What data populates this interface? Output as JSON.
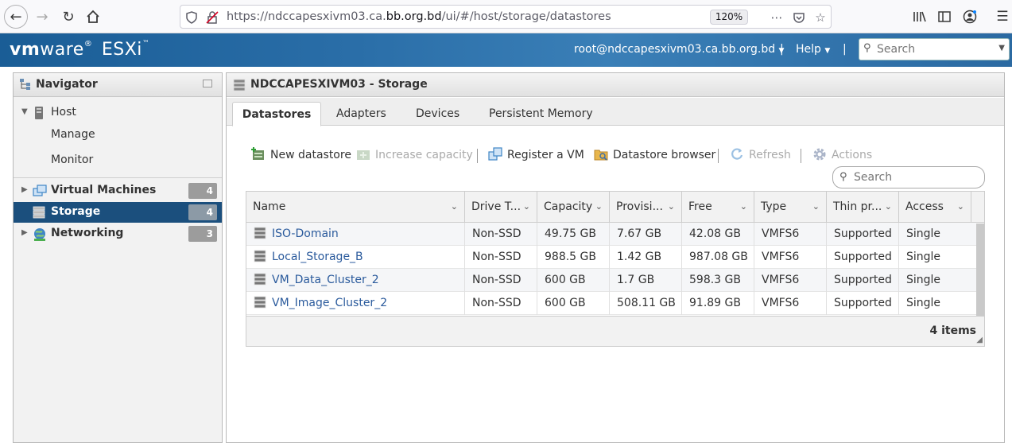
{
  "browser": {
    "url_prefix": "https://ndccapesxivm03.ca.",
    "url_domain": "bb.org.bd",
    "url_suffix": "/ui/#/host/storage/datastores",
    "zoom": "120%"
  },
  "header": {
    "brand_vm": "vm",
    "brand_ware": "ware",
    "brand_product": "ESXi",
    "user": "root@ndccapesxivm03.ca.bb.org.bd",
    "help": "Help",
    "search_placeholder": "Search"
  },
  "navigator": {
    "title": "Navigator",
    "host": "Host",
    "manage": "Manage",
    "monitor": "Monitor",
    "virtual_machines": "Virtual Machines",
    "virtual_machines_count": "4",
    "storage": "Storage",
    "storage_count": "4",
    "networking": "Networking",
    "networking_count": "3"
  },
  "main": {
    "title": "NDCCAPESXIVM03 - Storage",
    "tabs": [
      "Datastores",
      "Adapters",
      "Devices",
      "Persistent Memory"
    ],
    "toolbar": {
      "new_datastore": "New datastore",
      "increase_capacity": "Increase capacity",
      "register_vm": "Register a VM",
      "datastore_browser": "Datastore browser",
      "refresh": "Refresh",
      "actions": "Actions"
    },
    "search_placeholder": "Search",
    "columns": [
      "Name",
      "Drive T...",
      "Capacity",
      "Provisi...",
      "Free",
      "Type",
      "Thin pr...",
      "Access"
    ],
    "rows": [
      {
        "name": "ISO-Domain",
        "drive": "Non-SSD",
        "capacity": "49.75 GB",
        "provisioned": "7.67 GB",
        "free": "42.08 GB",
        "type": "VMFS6",
        "thin": "Supported",
        "access": "Single"
      },
      {
        "name": "Local_Storage_B",
        "drive": "Non-SSD",
        "capacity": "988.5 GB",
        "provisioned": "1.42 GB",
        "free": "987.08 GB",
        "type": "VMFS6",
        "thin": "Supported",
        "access": "Single"
      },
      {
        "name": "VM_Data_Cluster_2",
        "drive": "Non-SSD",
        "capacity": "600 GB",
        "provisioned": "1.7 GB",
        "free": "598.3 GB",
        "type": "VMFS6",
        "thin": "Supported",
        "access": "Single"
      },
      {
        "name": "VM_Image_Cluster_2",
        "drive": "Non-SSD",
        "capacity": "600 GB",
        "provisioned": "508.11 GB",
        "free": "91.89 GB",
        "type": "VMFS6",
        "thin": "Supported",
        "access": "Single"
      }
    ],
    "items_count": "4 items"
  },
  "colors": {
    "header_blue": "#2a6ea8",
    "selected_nav": "#1b4f7d",
    "link_blue": "#2a5a9c"
  }
}
